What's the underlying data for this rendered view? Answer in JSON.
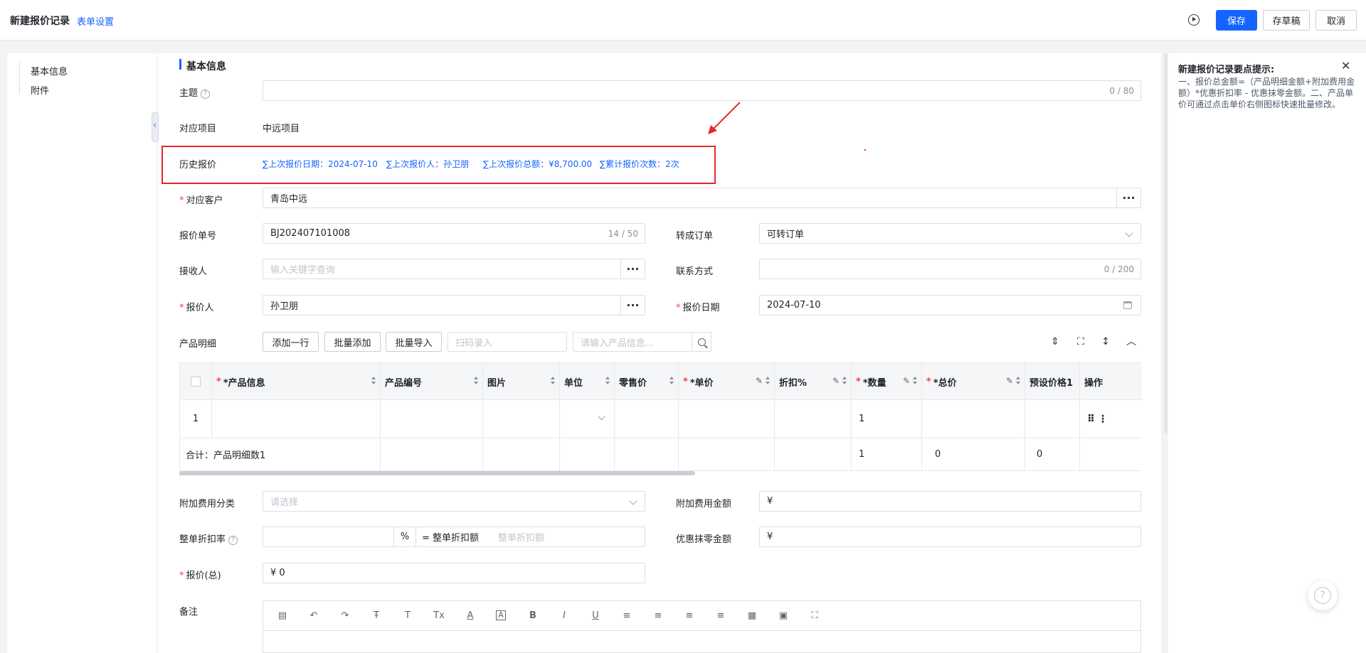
{
  "header": {
    "title": "新建报价记录",
    "form_settings": "表单设置",
    "save": "保存",
    "draft": "存草稿",
    "cancel": "取消"
  },
  "left_nav": {
    "items": [
      {
        "label": "基本信息"
      },
      {
        "label": "附件"
      }
    ]
  },
  "section": {
    "title": "基本信息"
  },
  "fields": {
    "subject": {
      "label": "主题",
      "count": "0 / 80"
    },
    "project": {
      "label": "对应项目",
      "value": "中远项目"
    },
    "history": {
      "label": "历史报价",
      "links": [
        "∑上次报价日期：2024-07-10",
        "∑上次报价人：孙卫朋",
        "∑上次报价总额：¥8,700.00",
        "∑累计报价次数：2次"
      ]
    },
    "customer": {
      "label": "对应客户",
      "value": "青岛中远"
    },
    "quote_no": {
      "label": "报价单号",
      "value": "BJ202407101008",
      "count": "14 / 50"
    },
    "to_order": {
      "label": "转成订单",
      "value": "可转订单"
    },
    "receiver": {
      "label": "接收人",
      "placeholder": "输入关键字查询"
    },
    "contact": {
      "label": "联系方式",
      "count": "0 / 200"
    },
    "quoter": {
      "label": "报价人",
      "value": "孙卫朋"
    },
    "quote_date": {
      "label": "报价日期",
      "value": "2024-07-10"
    },
    "products": {
      "label": "产品明细",
      "add_row": "添加一行",
      "batch_add": "批量添加",
      "batch_import": "批量导入",
      "scan_placeholder": "扫码录入",
      "search_placeholder": "请输入产品信息..."
    },
    "extra_category": {
      "label": "附加费用分类",
      "placeholder": "请选择"
    },
    "extra_amount": {
      "label": "附加费用金额",
      "prefix": "¥"
    },
    "discount": {
      "label": "整单折扣率",
      "unit": "%",
      "eq": "= 整单折扣额",
      "placeholder": "整单折扣额"
    },
    "rounding": {
      "label": "优惠抹零金额",
      "prefix": "¥"
    },
    "total": {
      "label": "报价(总)",
      "value": "¥ 0"
    },
    "remark": {
      "label": "备注"
    }
  },
  "table": {
    "headers": [
      "*产品信息",
      "产品编号",
      "图片",
      "单位",
      "零售价",
      "*单价",
      "折扣%",
      "*数量",
      "*总价",
      "预设价格1",
      "操作"
    ],
    "row": {
      "index": "1",
      "qty": "1"
    },
    "summary": {
      "label": "合计：产品明细数1",
      "qty": "1",
      "total": "0",
      "preset": "0"
    }
  },
  "tips": {
    "title": "新建报价记录要点提示:",
    "body": "一、报价总金额=（产品明细金额+附加费用金额）*优惠折扣率 - 优惠抹零金额。二、产品单价可通过点击单价右侧图标快速批量修改。"
  },
  "colors": {
    "accent": "#1664ff",
    "required": "#f53f3f",
    "highlight_box": "#e5282b"
  }
}
